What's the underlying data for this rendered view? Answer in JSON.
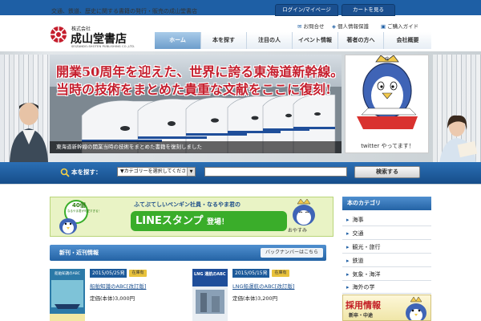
{
  "header": {
    "tagline": "交通、鉄道、歴史に関する書籍の発行・販売の成山堂書店",
    "login_label": "ログイン/マイページ",
    "cart_label": "カートを見る",
    "logo": {
      "kabushiki": "株式会社",
      "name": "成山堂書店",
      "english": "SEIZANDO-SHOTEN PUBLISHING CO.,LTD."
    },
    "util_links": [
      {
        "icon": "envelope-icon",
        "label": "お問合せ"
      },
      {
        "icon": "shield-icon",
        "label": "個人情報保護"
      },
      {
        "icon": "cart-icon",
        "label": "ご購入ガイド"
      }
    ],
    "nav": [
      {
        "label": "ホーム",
        "active": true
      },
      {
        "label": "本を探す"
      },
      {
        "label": "注目の人"
      },
      {
        "label": "イベント情報"
      },
      {
        "label": "著者の方へ"
      },
      {
        "label": "会社概要"
      }
    ]
  },
  "hero": {
    "headline_1": "開業50周年を迎えた、世界に誇る東海道新幹線。",
    "headline_2": "当時の技術をまとめた貴重な文献をここに復刻!",
    "caption": "東海道新幹線の開業当時の技術をまとめた書籍を復刻しました",
    "twitter_label": "twitter やってます！",
    "mascot_badge": "成"
  },
  "search": {
    "label": "本を探す：",
    "category_value": "▼カテゴリーを選択してください",
    "input_placeholder": "",
    "button_label": "検索する"
  },
  "line_banner": {
    "badge_number": "40個",
    "badge_sub": "なるやま君が可愛すぎる！",
    "top_text": "ふてぶてしいペンギン社員・なるやま君の",
    "main_text": "LINEスタンプ",
    "main_suffix": "登場！",
    "oyasumi": "おやすみ"
  },
  "new_books": {
    "title": "新刊・近刊情報",
    "back_label": "バックナンバーはこちら",
    "items": [
      {
        "date": "2015/05/25発",
        "tag": "在庫有",
        "title": "船舶知識のABC[改訂版]",
        "price": "定価(本体)3,000円",
        "cover_text": "船舶知識のABC"
      },
      {
        "date": "2015/05/15発",
        "tag": "在庫有",
        "title": "LNG船運航のABC[改訂版]",
        "price": "定価(本体)3,200円",
        "cover_text": "LNG 運航のABC"
      }
    ]
  },
  "sidebar": {
    "title": "本のカテゴリ",
    "items": [
      "海事",
      "交通",
      "観光・旅行",
      "鉄道",
      "気象・海洋",
      "海外の学"
    ]
  },
  "recruit": {
    "title": "採用情報",
    "sub": "新卒・中途"
  },
  "colors": {
    "brand_blue": "#1e5fa5",
    "headline_red": "#c51e2d",
    "line_green": "#3aad2a"
  }
}
